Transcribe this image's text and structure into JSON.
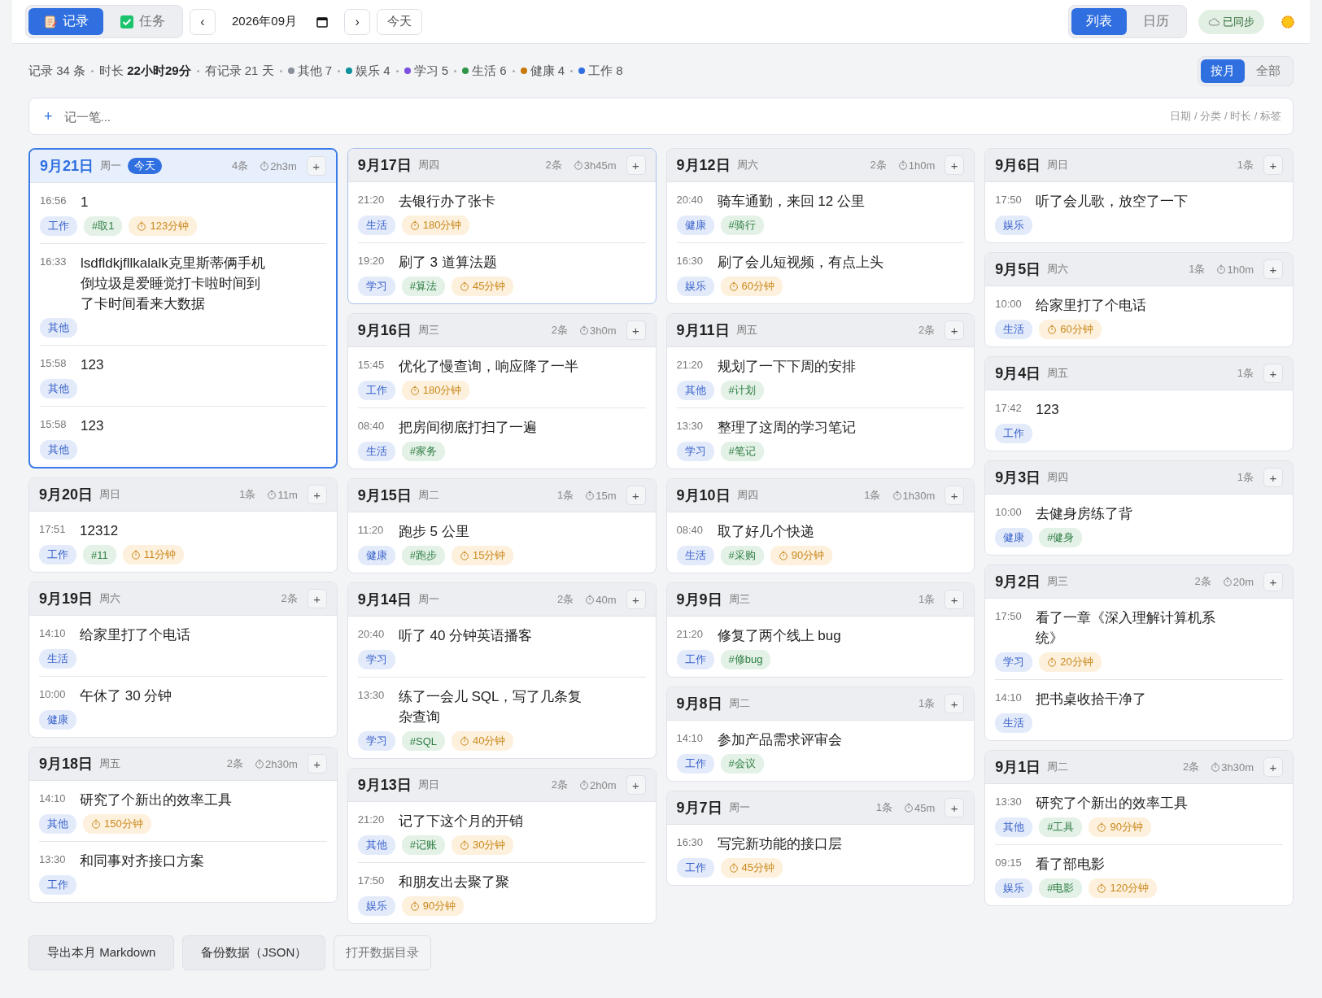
{
  "toolbar": {
    "modes": [
      {
        "label": "记录",
        "kind": "notebook",
        "selected": true
      },
      {
        "label": "任务",
        "kind": "checkbox",
        "selected": false
      }
    ],
    "prev": "‹",
    "month": "2026年09月",
    "next": "›",
    "today": "今天",
    "views": [
      {
        "label": "列表",
        "selected": true
      },
      {
        "label": "日历",
        "selected": false
      }
    ],
    "sync": "已同步"
  },
  "stats": [
    {
      "kind": "stat",
      "text": "记录 34 条"
    },
    {
      "kind": "stat",
      "text": "时长 **22小时29分**"
    },
    {
      "kind": "stat",
      "text": "有记录 21 天"
    },
    {
      "kind": "category",
      "text": "其他 7",
      "color": "#8a8f99"
    },
    {
      "kind": "category",
      "text": "娱乐 4",
      "color": "#0e8f9c"
    },
    {
      "kind": "category",
      "text": "学习 5",
      "color": "#7b4fe0"
    },
    {
      "kind": "category",
      "text": "生活 6",
      "color": "#2e9447"
    },
    {
      "kind": "category",
      "text": "健康 4",
      "color": "#c77a0c"
    },
    {
      "kind": "category",
      "text": "工作 8",
      "color": "#2f6fe0"
    }
  ],
  "scopes": [
    {
      "label": "按月",
      "selected": true
    },
    {
      "label": "全部",
      "selected": false
    }
  ],
  "quick_add": {
    "plus": "+",
    "placeholder": "记一笔...",
    "hint": "日期 / 分类 / 时长 / 标签"
  },
  "columns": [
    {
      "days": [
        {
          "date": "9月21日",
          "weekday": "周一",
          "badge": "今天",
          "today": true,
          "highlighted": false,
          "count": "4条",
          "duration": "2h3m",
          "add": "+",
          "entries": [
            {
              "time": "16:56",
              "text": "1",
              "tags": [
                {
                  "kind": "category",
                  "text": "工作"
                },
                {
                  "kind": "tag",
                  "text": "#取1"
                },
                {
                  "kind": "duration",
                  "text": "123分钟"
                }
              ]
            },
            {
              "time": "16:33",
              "text": "lsdfldkjfllkalalk克里斯蒂俩手机倒垃圾是爱睡觉打卡啦时间到了卡时间看来大数据",
              "tags": [
                {
                  "kind": "category",
                  "text": "其他"
                }
              ]
            },
            {
              "time": "15:58",
              "text": "123",
              "tags": [
                {
                  "kind": "category",
                  "text": "其他"
                }
              ]
            },
            {
              "time": "15:58",
              "text": "123",
              "tags": [
                {
                  "kind": "category",
                  "text": "其他"
                }
              ]
            }
          ]
        },
        {
          "date": "9月20日",
          "weekday": "周日",
          "today": false,
          "highlighted": false,
          "count": "1条",
          "duration": "11m",
          "add": "+",
          "entries": [
            {
              "time": "17:51",
              "text": "12312",
              "tags": [
                {
                  "kind": "category",
                  "text": "工作"
                },
                {
                  "kind": "tag",
                  "text": "#11"
                },
                {
                  "kind": "duration",
                  "text": "11分钟"
                }
              ]
            }
          ]
        },
        {
          "date": "9月19日",
          "weekday": "周六",
          "today": false,
          "highlighted": false,
          "count": "2条",
          "add": "+",
          "entries": [
            {
              "time": "14:10",
              "text": "给家里打了个电话",
              "tags": [
                {
                  "kind": "category",
                  "text": "生活"
                }
              ]
            },
            {
              "time": "10:00",
              "text": "午休了 30 分钟",
              "tags": [
                {
                  "kind": "category",
                  "text": "健康"
                }
              ]
            }
          ]
        },
        {
          "date": "9月18日",
          "weekday": "周五",
          "today": false,
          "highlighted": false,
          "count": "2条",
          "duration": "2h30m",
          "add": "+",
          "entries": [
            {
              "time": "14:10",
              "text": "研究了个新出的效率工具",
              "tags": [
                {
                  "kind": "category",
                  "text": "其他"
                },
                {
                  "kind": "duration",
                  "text": "150分钟"
                }
              ]
            },
            {
              "time": "13:30",
              "text": "和同事对齐接口方案",
              "tags": [
                {
                  "kind": "category",
                  "text": "工作"
                }
              ]
            }
          ]
        }
      ]
    },
    {
      "days": [
        {
          "date": "9月17日",
          "weekday": "周四",
          "today": false,
          "highlighted": true,
          "count": "2条",
          "duration": "3h45m",
          "add": "+",
          "entries": [
            {
              "time": "21:20",
              "text": "去银行办了张卡",
              "tags": [
                {
                  "kind": "category",
                  "text": "生活"
                },
                {
                  "kind": "duration",
                  "text": "180分钟"
                }
              ]
            },
            {
              "time": "19:20",
              "text": "刷了 3 道算法题",
              "tags": [
                {
                  "kind": "category",
                  "text": "学习"
                },
                {
                  "kind": "tag",
                  "text": "#算法"
                },
                {
                  "kind": "duration",
                  "text": "45分钟"
                }
              ]
            }
          ]
        },
        {
          "date": "9月16日",
          "weekday": "周三",
          "today": false,
          "highlighted": false,
          "count": "2条",
          "duration": "3h0m",
          "add": "+",
          "entries": [
            {
              "time": "15:45",
              "text": "优化了慢查询，响应降了一半",
              "tags": [
                {
                  "kind": "category",
                  "text": "工作"
                },
                {
                  "kind": "duration",
                  "text": "180分钟"
                }
              ]
            },
            {
              "time": "08:40",
              "text": "把房间彻底打扫了一遍",
              "tags": [
                {
                  "kind": "category",
                  "text": "生活"
                },
                {
                  "kind": "tag",
                  "text": "#家务"
                }
              ]
            }
          ]
        },
        {
          "date": "9月15日",
          "weekday": "周二",
          "today": false,
          "highlighted": false,
          "count": "1条",
          "duration": "15m",
          "add": "+",
          "entries": [
            {
              "time": "11:20",
              "text": "跑步 5 公里",
              "tags": [
                {
                  "kind": "category",
                  "text": "健康"
                },
                {
                  "kind": "tag",
                  "text": "#跑步"
                },
                {
                  "kind": "duration",
                  "text": "15分钟"
                }
              ]
            }
          ]
        },
        {
          "date": "9月14日",
          "weekday": "周一",
          "today": false,
          "highlighted": false,
          "count": "2条",
          "duration": "40m",
          "add": "+",
          "entries": [
            {
              "time": "20:40",
              "text": "听了 40 分钟英语播客",
              "tags": [
                {
                  "kind": "category",
                  "text": "学习"
                }
              ]
            },
            {
              "time": "13:30",
              "text": "练了一会儿 SQL，写了几条复杂查询",
              "tags": [
                {
                  "kind": "category",
                  "text": "学习"
                },
                {
                  "kind": "tag",
                  "text": "#SQL"
                },
                {
                  "kind": "duration",
                  "text": "40分钟"
                }
              ]
            }
          ]
        },
        {
          "date": "9月13日",
          "weekday": "周日",
          "today": false,
          "highlighted": false,
          "count": "2条",
          "duration": "2h0m",
          "add": "+",
          "entries": [
            {
              "time": "21:20",
              "text": "记了下这个月的开销",
              "tags": [
                {
                  "kind": "category",
                  "text": "其他"
                },
                {
                  "kind": "tag",
                  "text": "#记账"
                },
                {
                  "kind": "duration",
                  "text": "30分钟"
                }
              ]
            },
            {
              "time": "17:50",
              "text": "和朋友出去聚了聚",
              "tags": [
                {
                  "kind": "category",
                  "text": "娱乐"
                },
                {
                  "kind": "duration",
                  "text": "90分钟"
                }
              ]
            }
          ]
        }
      ]
    },
    {
      "days": [
        {
          "date": "9月12日",
          "weekday": "周六",
          "today": false,
          "highlighted": false,
          "count": "2条",
          "duration": "1h0m",
          "add": "+",
          "entries": [
            {
              "time": "20:40",
              "text": "骑车通勤，来回 12 公里",
              "tags": [
                {
                  "kind": "category",
                  "text": "健康"
                },
                {
                  "kind": "tag",
                  "text": "#骑行"
                }
              ]
            },
            {
              "time": "16:30",
              "text": "刷了会儿短视频，有点上头",
              "tags": [
                {
                  "kind": "category",
                  "text": "娱乐"
                },
                {
                  "kind": "duration",
                  "text": "60分钟"
                }
              ]
            }
          ]
        },
        {
          "date": "9月11日",
          "weekday": "周五",
          "today": false,
          "highlighted": false,
          "count": "2条",
          "add": "+",
          "entries": [
            {
              "time": "21:20",
              "text": "规划了一下下周的安排",
              "tags": [
                {
                  "kind": "category",
                  "text": "其他"
                },
                {
                  "kind": "tag",
                  "text": "#计划"
                }
              ]
            },
            {
              "time": "13:30",
              "text": "整理了这周的学习笔记",
              "tags": [
                {
                  "kind": "category",
                  "text": "学习"
                },
                {
                  "kind": "tag",
                  "text": "#笔记"
                }
              ]
            }
          ]
        },
        {
          "date": "9月10日",
          "weekday": "周四",
          "today": false,
          "highlighted": false,
          "count": "1条",
          "duration": "1h30m",
          "add": "+",
          "entries": [
            {
              "time": "08:40",
              "text": "取了好几个快递",
              "tags": [
                {
                  "kind": "category",
                  "text": "生活"
                },
                {
                  "kind": "tag",
                  "text": "#采购"
                },
                {
                  "kind": "duration",
                  "text": "90分钟"
                }
              ]
            }
          ]
        },
        {
          "date": "9月9日",
          "weekday": "周三",
          "today": false,
          "highlighted": false,
          "count": "1条",
          "add": "+",
          "entries": [
            {
              "time": "21:20",
              "text": "修复了两个线上 bug",
              "tags": [
                {
                  "kind": "category",
                  "text": "工作"
                },
                {
                  "kind": "tag",
                  "text": "#修bug"
                }
              ]
            }
          ]
        },
        {
          "date": "9月8日",
          "weekday": "周二",
          "today": false,
          "highlighted": false,
          "count": "1条",
          "add": "+",
          "entries": [
            {
              "time": "14:10",
              "text": "参加产品需求评审会",
              "tags": [
                {
                  "kind": "category",
                  "text": "工作"
                },
                {
                  "kind": "tag",
                  "text": "#会议"
                }
              ]
            }
          ]
        },
        {
          "date": "9月7日",
          "weekday": "周一",
          "today": false,
          "highlighted": false,
          "count": "1条",
          "duration": "45m",
          "add": "+",
          "entries": [
            {
              "time": "16:30",
              "text": "写完新功能的接口层",
              "tags": [
                {
                  "kind": "category",
                  "text": "工作"
                },
                {
                  "kind": "duration",
                  "text": "45分钟"
                }
              ]
            }
          ]
        }
      ]
    },
    {
      "days": [
        {
          "date": "9月6日",
          "weekday": "周日",
          "today": false,
          "highlighted": false,
          "count": "1条",
          "add": "+",
          "entries": [
            {
              "time": "17:50",
              "text": "听了会儿歌，放空了一下",
              "tags": [
                {
                  "kind": "category",
                  "text": "娱乐"
                }
              ]
            }
          ]
        },
        {
          "date": "9月5日",
          "weekday": "周六",
          "today": false,
          "highlighted": false,
          "count": "1条",
          "duration": "1h0m",
          "add": "+",
          "entries": [
            {
              "time": "10:00",
              "text": "给家里打了个电话",
              "tags": [
                {
                  "kind": "category",
                  "text": "生活"
                },
                {
                  "kind": "duration",
                  "text": "60分钟"
                }
              ]
            }
          ]
        },
        {
          "date": "9月4日",
          "weekday": "周五",
          "today": false,
          "highlighted": false,
          "count": "1条",
          "add": "+",
          "entries": [
            {
              "time": "17:42",
              "text": "123",
              "tags": [
                {
                  "kind": "category",
                  "text": "工作"
                }
              ]
            }
          ]
        },
        {
          "date": "9月3日",
          "weekday": "周四",
          "today": false,
          "highlighted": false,
          "count": "1条",
          "add": "+",
          "entries": [
            {
              "time": "10:00",
              "text": "去健身房练了背",
              "tags": [
                {
                  "kind": "category",
                  "text": "健康"
                },
                {
                  "kind": "tag",
                  "text": "#健身"
                }
              ]
            }
          ]
        },
        {
          "date": "9月2日",
          "weekday": "周三",
          "today": false,
          "highlighted": false,
          "count": "2条",
          "duration": "20m",
          "add": "+",
          "entries": [
            {
              "time": "17:50",
              "text": "看了一章《深入理解计算机系统》",
              "tags": [
                {
                  "kind": "category",
                  "text": "学习"
                },
                {
                  "kind": "duration",
                  "text": "20分钟"
                }
              ]
            },
            {
              "time": "14:10",
              "text": "把书桌收拾干净了",
              "tags": [
                {
                  "kind": "category",
                  "text": "生活"
                }
              ]
            }
          ]
        },
        {
          "date": "9月1日",
          "weekday": "周二",
          "today": false,
          "highlighted": false,
          "count": "2条",
          "duration": "3h30m",
          "add": "+",
          "entries": [
            {
              "time": "13:30",
              "text": "研究了个新出的效率工具",
              "tags": [
                {
                  "kind": "category",
                  "text": "其他"
                },
                {
                  "kind": "tag",
                  "text": "#工具"
                },
                {
                  "kind": "duration",
                  "text": "90分钟"
                }
              ]
            },
            {
              "time": "09:15",
              "text": "看了部电影",
              "tags": [
                {
                  "kind": "category",
                  "text": "娱乐"
                },
                {
                  "kind": "tag",
                  "text": "#电影"
                },
                {
                  "kind": "duration",
                  "text": "120分钟"
                }
              ]
            }
          ]
        }
      ]
    }
  ],
  "footer_buttons": [
    {
      "label": "导出本月 Markdown",
      "kind": "filled"
    },
    {
      "label": "备份数据（JSON）",
      "kind": "filled"
    },
    {
      "label": "打开数据目录",
      "kind": "outline"
    }
  ]
}
